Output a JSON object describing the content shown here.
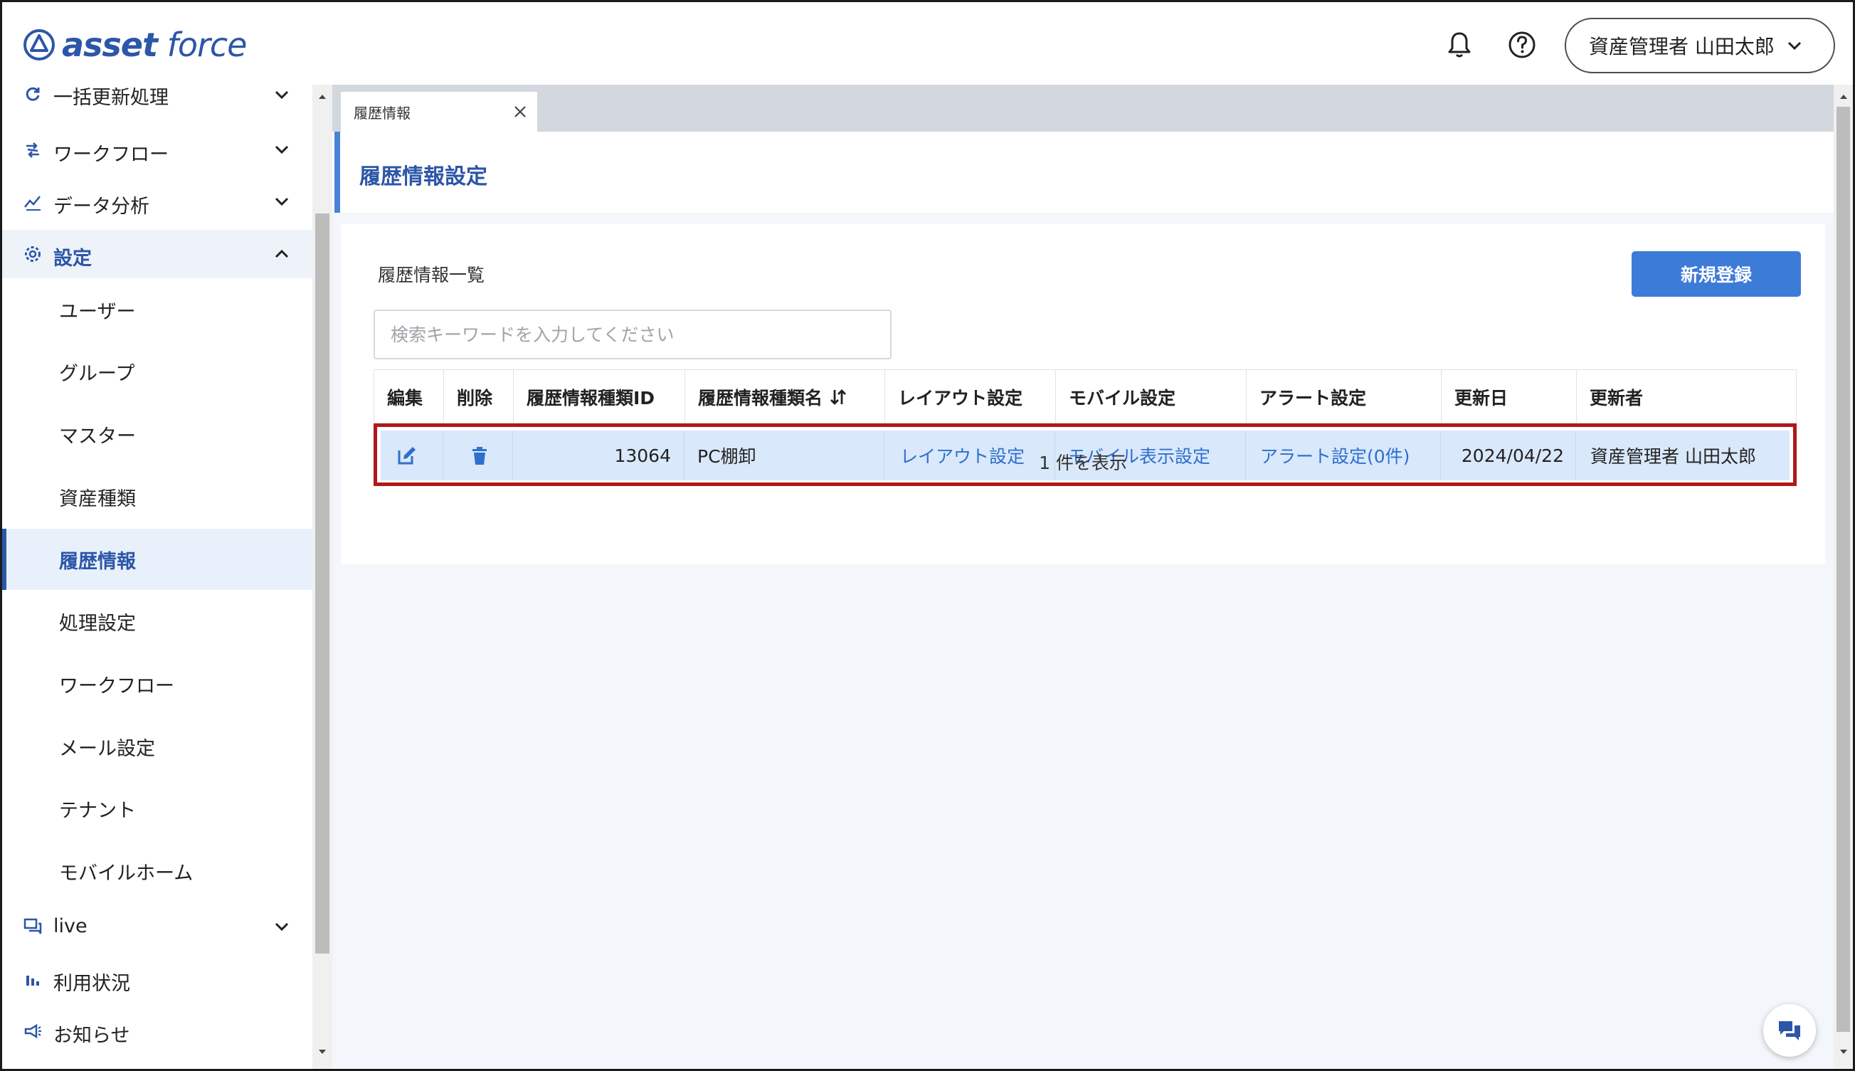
{
  "header": {
    "logo_brand": "asset",
    "logo_suffix": "force",
    "user_menu_label": "資産管理者 山田太郎"
  },
  "sidebar": {
    "items_top": [
      {
        "label": "一括更新処理",
        "icon": "refresh-icon"
      },
      {
        "label": "ワークフロー",
        "icon": "workflow-icon"
      },
      {
        "label": "データ分析",
        "icon": "analytics-icon"
      },
      {
        "label": "設定",
        "icon": "gear-icon"
      }
    ],
    "sub_items": [
      {
        "label": "ユーザー"
      },
      {
        "label": "グループ"
      },
      {
        "label": "マスター"
      },
      {
        "label": "資産種類"
      },
      {
        "label": "履歴情報"
      },
      {
        "label": "処理設定"
      },
      {
        "label": "ワークフロー"
      },
      {
        "label": "メール設定"
      },
      {
        "label": "テナント"
      },
      {
        "label": "モバイルホーム"
      }
    ],
    "items_bottom": [
      {
        "label": "live",
        "icon": "chat-icon"
      },
      {
        "label": "利用状況",
        "icon": "bar-chart-icon"
      },
      {
        "label": "お知らせ",
        "icon": "megaphone-icon"
      }
    ]
  },
  "tabs": [
    {
      "label": "履歴情報"
    }
  ],
  "page": {
    "title": "履歴情報設定",
    "section_title": "履歴情報一覧",
    "new_button": "新規登録",
    "search_placeholder": "検索キーワードを入力してください",
    "count_text": "1 件を表示"
  },
  "table": {
    "columns": [
      "編集",
      "削除",
      "履歴情報種類ID",
      "履歴情報種類名",
      "レイアウト設定",
      "モバイル設定",
      "アラート設定",
      "更新日",
      "更新者"
    ],
    "rows": [
      {
        "id": "13064",
        "name": "PC棚卸",
        "layout": "レイアウト設定",
        "mobile": "モバイル表示設定",
        "alert": "アラート設定(0件)",
        "updated": "2024/04/22",
        "updater": "資産管理者 山田太郎"
      }
    ]
  },
  "colors": {
    "brand": "#2c56a8",
    "primary_button": "#3d7bd9",
    "link": "#2f6fce",
    "row_selected": "#d9e8fa",
    "highlight_border": "#b21818"
  }
}
